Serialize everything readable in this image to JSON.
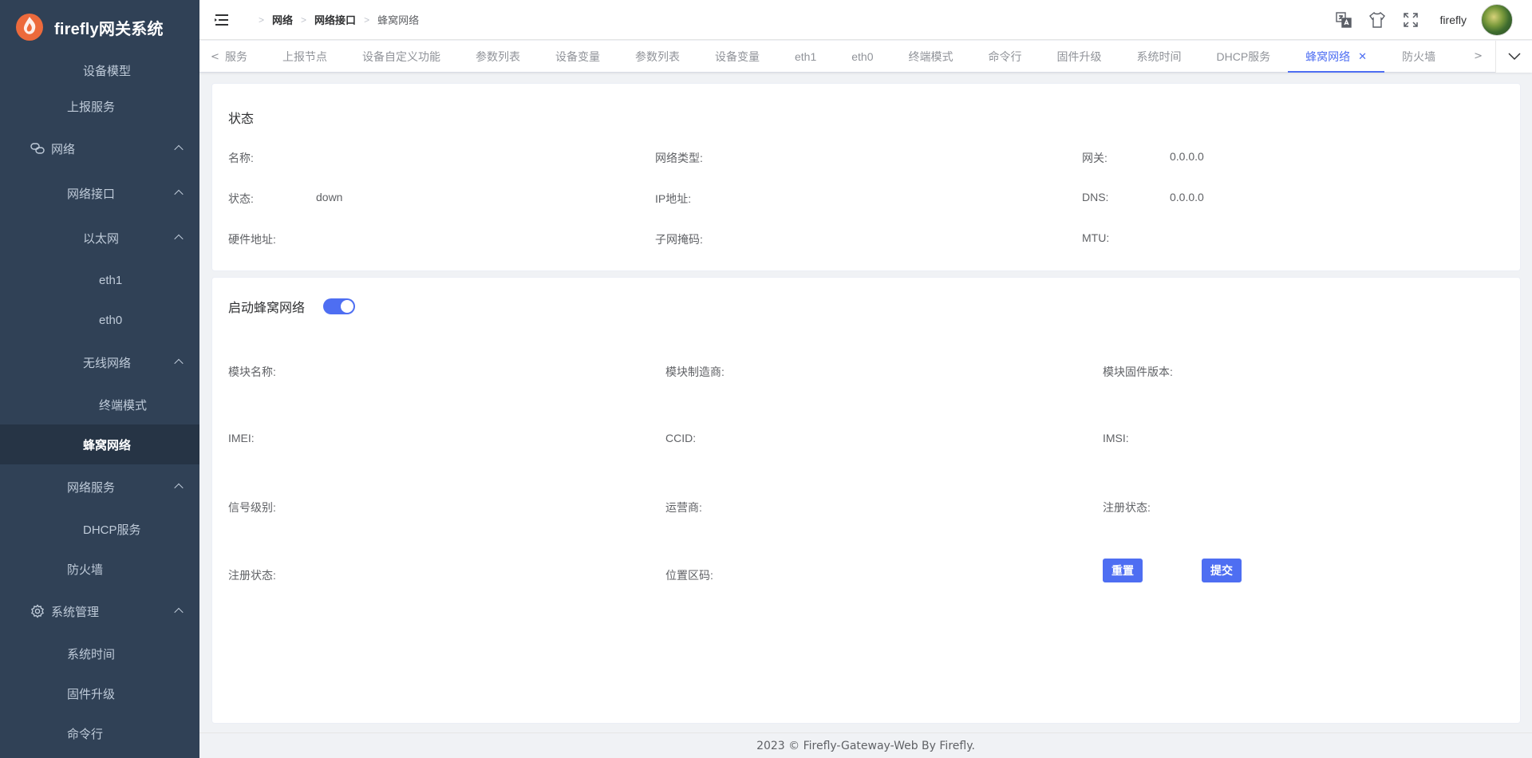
{
  "app": {
    "title": "firefly网关系统"
  },
  "sidebar": {
    "items": [
      {
        "label": "设备模型",
        "indent": 2
      },
      {
        "label": "上报服务",
        "indent": 1
      },
      {
        "label": "网络",
        "indent": 0,
        "expandable": true,
        "icon": "network-icon"
      },
      {
        "label": "网络接口",
        "indent": 1,
        "expandable": true
      },
      {
        "label": "以太网",
        "indent": 2,
        "expandable": true
      },
      {
        "label": "eth1",
        "indent": 3
      },
      {
        "label": "eth0",
        "indent": 3
      },
      {
        "label": "无线网络",
        "indent": 2,
        "expandable": true
      },
      {
        "label": "终端模式",
        "indent": 3
      },
      {
        "label": "蜂窝网络",
        "indent": 2,
        "active": true
      },
      {
        "label": "网络服务",
        "indent": 1,
        "expandable": true
      },
      {
        "label": "DHCP服务",
        "indent": 2
      },
      {
        "label": "防火墙",
        "indent": 1
      },
      {
        "label": "系统管理",
        "indent": 0,
        "expandable": true,
        "icon": "gear-icon"
      },
      {
        "label": "系统时间",
        "indent": 1
      },
      {
        "label": "固件升级",
        "indent": 1
      },
      {
        "label": "命令行",
        "indent": 1
      }
    ]
  },
  "breadcrumb": [
    "网络",
    "网络接口",
    "蜂窝网络"
  ],
  "header": {
    "username": "firefly"
  },
  "tags": [
    {
      "label": "服务"
    },
    {
      "label": "上报节点"
    },
    {
      "label": "设备自定义功能"
    },
    {
      "label": "参数列表"
    },
    {
      "label": "设备变量"
    },
    {
      "label": "参数列表"
    },
    {
      "label": "设备变量"
    },
    {
      "label": "eth1"
    },
    {
      "label": "eth0"
    },
    {
      "label": "终端模式"
    },
    {
      "label": "命令行"
    },
    {
      "label": "固件升级"
    },
    {
      "label": "系统时间"
    },
    {
      "label": "DHCP服务"
    },
    {
      "label": "蜂窝网络",
      "active": true
    },
    {
      "label": "防火墙"
    }
  ],
  "status": {
    "title": "状态",
    "name_label": "名称:",
    "name_value": "",
    "nettype_label": "网络类型:",
    "nettype_value": "",
    "gateway_label": "网关:",
    "gateway_value": "0.0.0.0",
    "state_label": "状态:",
    "state_value": "down",
    "ip_label": "IP地址:",
    "ip_value": "",
    "dns_label": "DNS:",
    "dns_value": "0.0.0.0",
    "mac_label": "硬件地址:",
    "mac_value": "",
    "mask_label": "子网掩码:",
    "mask_value": "",
    "mtu_label": "MTU:",
    "mtu_value": ""
  },
  "cellular": {
    "enable_label": "启动蜂窝网络",
    "enabled": true,
    "module_name_label": "模块名称:",
    "module_vendor_label": "模块制造商:",
    "module_fw_label": "模块固件版本:",
    "imei_label": "IMEI:",
    "ccid_label": "CCID:",
    "imsi_label": "IMSI:",
    "signal_label": "信号级别:",
    "carrier_label": "运营商:",
    "reg_status_label": "注册状态:",
    "reg_status2_label": "注册状态:",
    "lac_label": "位置区码:",
    "reset_label": "重置",
    "submit_label": "提交"
  },
  "footer": {
    "text": "2023 © Firefly-Gateway-Web By Firefly."
  },
  "colors": {
    "sidebar_bg": "#304156",
    "accent": "#4e6ef2",
    "logo": "#ec6a3c"
  }
}
